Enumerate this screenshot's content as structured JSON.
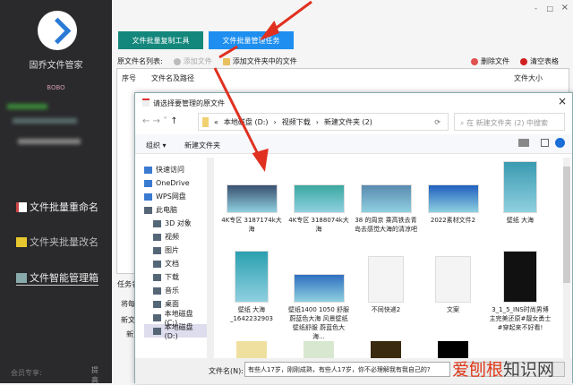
{
  "sidebar": {
    "app_name": "固乔文件管家",
    "user": "BOBO",
    "items": [
      {
        "label": "文件批量重命名"
      },
      {
        "label": "文件夹批量改名"
      },
      {
        "label": "文件智能管理箱"
      }
    ],
    "footer": "会员专享:",
    "footer_side": "提高"
  },
  "window": {
    "minimize": "-",
    "maximize": "□",
    "close": "×"
  },
  "main": {
    "tabs": [
      {
        "label": "文件批量复制工具",
        "color": "#14877c"
      },
      {
        "label": "文件批量管理任务",
        "color": "#1e8ff0"
      }
    ],
    "list_label": "原文件名列表:",
    "add_file": "添加文件",
    "add_folder": "添加文件夹中的文件",
    "delete_file": "删除文件",
    "clear_table": "清空表格",
    "columns": [
      "序号",
      "文件名及路径",
      "文件大小"
    ],
    "side_labels": [
      "任务名",
      "将每",
      "新文件",
      "新文"
    ]
  },
  "dialog": {
    "title": "请选择要管理的原文件",
    "close": "×",
    "path": [
      "本地磁盘 (D:)",
      "视频下载",
      "新建文件夹 (2)"
    ],
    "path_prefix": "«",
    "search_placeholder": "在 新建文件夹 (2) 中搜索",
    "organize": "组织 ▾",
    "new_folder": "新建文件夹",
    "nav": [
      {
        "label": "快速访问",
        "icon": "star-icon"
      },
      {
        "label": "OneDrive",
        "icon": "cloud-icon"
      },
      {
        "label": "WPS网盘",
        "icon": "cloud-icon"
      },
      {
        "label": "此电脑",
        "icon": "computer-icon"
      },
      {
        "label": "3D 对象",
        "icon": "cube-icon"
      },
      {
        "label": "视频",
        "icon": "video-icon"
      },
      {
        "label": "图片",
        "icon": "picture-icon"
      },
      {
        "label": "文档",
        "icon": "document-icon"
      },
      {
        "label": "下载",
        "icon": "download-icon"
      },
      {
        "label": "音乐",
        "icon": "music-icon"
      },
      {
        "label": "桌面",
        "icon": "desktop-icon"
      },
      {
        "label": "本地磁盘 (C:)",
        "icon": "drive-icon"
      },
      {
        "label": "本地磁盘 (D:)",
        "icon": "drive-icon"
      }
    ],
    "files": [
      {
        "name": "4K专区 3187174k大海",
        "kind": "landscape",
        "color": "#3a5070"
      },
      {
        "name": "4K专区 3188074k大海",
        "kind": "landscape",
        "color": "#3aa8a0"
      },
      {
        "name": "38 的周京 乘高铁去青岛去感觉大海的清凉吧",
        "kind": "landscape",
        "color": "#5a8ab0"
      },
      {
        "name": "2022素材文件2",
        "kind": "landscape",
        "color": "#2060c0"
      },
      {
        "name": "壁纸 大海",
        "kind": "portrait",
        "color": "#3a9ab0"
      },
      {
        "name": "壁纸 大海 _1642232903",
        "kind": "portrait",
        "color": "#2aa0b0"
      },
      {
        "name": "壁纸1400 1050 舒服 蔚蓝色大海 风景壁纸壁纸舒服 蔚蓝色大海...",
        "kind": "landscape",
        "color": "#3070c0"
      },
      {
        "name": "不同快递2",
        "kind": "doc",
        "color": "#f2f2f2"
      },
      {
        "name": "文案",
        "kind": "doc",
        "color": "#f2f2f2"
      },
      {
        "name": "3_1_5_INS时尚男博主完美还原#靓女勇士#穿起来不好看!",
        "kind": "portrait",
        "color": "#111111"
      }
    ],
    "more_thumbs": [
      "#f0e0a0",
      "#d8e8d0",
      "#3a2a10",
      "#000000"
    ],
    "filename_label": "文件名(N):",
    "filename_value": "有些人17岁，刚刚成熟，有些人17岁，你不必理解我有我自己的?"
  },
  "watermark": "爱刨根知识网"
}
